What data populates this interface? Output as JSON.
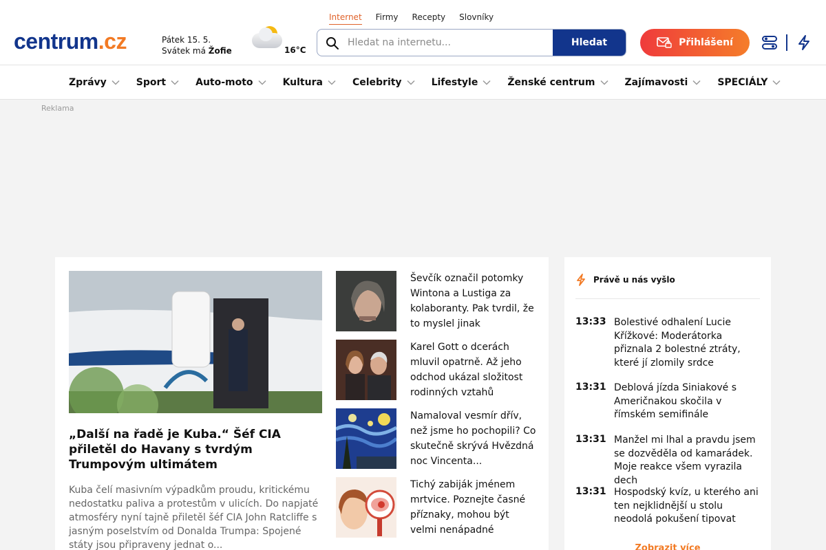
{
  "header": {
    "logo": {
      "main": "centrum",
      "suffix": ".cz"
    },
    "date": {
      "day": "Pátek 15. 5.",
      "nameday_prefix": "Svátek má",
      "nameday_name": "Žofie"
    },
    "weather": {
      "temperature": "16°C",
      "icon": "partly-cloudy-icon"
    },
    "top_tabs": [
      {
        "label": "Internet",
        "active": true
      },
      {
        "label": "Firmy",
        "active": false
      },
      {
        "label": "Recepty",
        "active": false
      },
      {
        "label": "Slovníky",
        "active": false
      }
    ],
    "search": {
      "placeholder": "Hledat na internetu...",
      "value": "",
      "button_label": "Hledat"
    },
    "login_label": "Přihlášení"
  },
  "nav": {
    "items": [
      "Zprávy",
      "Sport",
      "Auto-moto",
      "Kultura",
      "Celebrity",
      "Lifestyle",
      "Ženské centrum",
      "Zajímavosti",
      "SPECIÁLY"
    ]
  },
  "ad_label": "Reklama",
  "main": {
    "hero": {
      "title": "„Další na řadě je Kuba.“ Šéf CIA přiletěl do Havany s tvrdým Trumpovým ultimátem",
      "perex": "Kuba čelí masivním výpadkům proudu, kritickému nedostatku paliva a protestům v ulicích. Do napjaté atmosféry nyní tajně přiletěl šéf CIA John Ratcliffe s jasným poselstvím od Donalda Trumpa: Spojené státy jsou připraveny jednat o..."
    },
    "side_articles": [
      {
        "title": "Ševčík označil potomky Wintona a Lustiga za kolaboranty. Pak tvrdil, že to myslel jinak"
      },
      {
        "title": "Karel Gott o dcerách mluvil opatrně. Až jeho odchod ukázal složitost rodinných vztahů"
      },
      {
        "title": "Namaloval vesmír dřív, než jsme ho pochopili? Co skutečně skrývá Hvězdná noc Vincenta..."
      },
      {
        "title": "Tichý zabiják jménem mrtvice. Poznejte časné příznaky, mohou být velmi nenápadné"
      }
    ]
  },
  "latest": {
    "heading": "Právě u nás vyšlo",
    "items": [
      {
        "time": "13:33",
        "title": "Bolestivé odhalení Lucie Křížkové: Moderátorka přiznala 2 bolestné ztráty, které jí zlomily srdce"
      },
      {
        "time": "13:31",
        "title": "Deblová jízda Siniakové s Američnakou skočila v římském semifinále"
      },
      {
        "time": "13:31",
        "title": "Manžel mi lhal a pravdu jsem se dozvěděla od kamarádek. Moje reakce všem vyrazila dech"
      },
      {
        "time": "13:31",
        "title": "Hospodský kvíz, u kterého ani ten nejklidnější u stolu neodolá pokušení tipovat"
      }
    ],
    "more_label": "Zobrazit více"
  },
  "colors": {
    "brand_blue": "#12358c",
    "brand_orange": "#f27a24",
    "login_gradient_start": "#ef3b3b",
    "login_gradient_end": "#f57d2a"
  }
}
